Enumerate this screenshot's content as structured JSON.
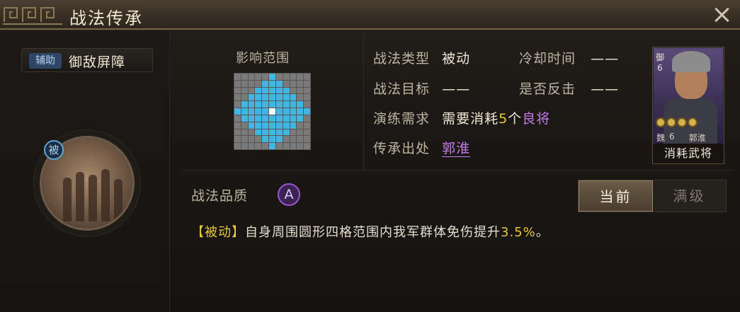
{
  "header": {
    "title": "战法传承"
  },
  "skill": {
    "tag": "辅助",
    "name": "御敌屏障",
    "badge": "被"
  },
  "range": {
    "title": "影响范围"
  },
  "info": {
    "type_label": "战法类型",
    "type_value": "被动",
    "cooldown_label": "冷却时间",
    "cooldown_value": "——",
    "target_label": "战法目标",
    "target_value": "——",
    "counter_label": "是否反击",
    "counter_value": "——",
    "req_label": "演练需求",
    "req_prefix": "需要消耗",
    "req_count": "5",
    "req_unit": "个",
    "req_quality": "良将",
    "source_label": "传承出处",
    "source_value": "郭淮"
  },
  "general_card": {
    "side_text": "御 6",
    "faction": "魏",
    "level": "6",
    "name": "郭淮",
    "stars": 4,
    "caption": "消耗武将"
  },
  "quality": {
    "label": "战法品质",
    "grade": "A"
  },
  "toggle": {
    "current": "当前",
    "max": "满级"
  },
  "description": {
    "bracket": "【被动】",
    "text": "自身周围圆形四格范围内我军群体免伤提升",
    "value": "3.5%",
    "end": "。"
  },
  "colors": {
    "range_cell": "#3fb7e3",
    "highlight_yellow": "#e9c63c",
    "highlight_purple": "#c57be6"
  }
}
